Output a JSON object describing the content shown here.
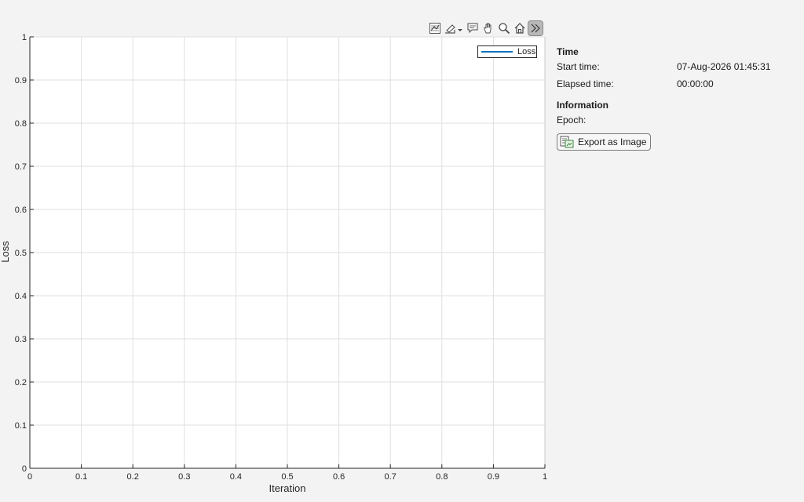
{
  "toolbar": {
    "icons": [
      "export-axes-icon",
      "brush-icon",
      "data-tips-icon",
      "pan-icon",
      "zoom-icon",
      "home-icon",
      "collapse-toolbar-icon"
    ]
  },
  "panel": {
    "time_title": "Time",
    "start_time_label": "Start time:",
    "start_time_value": "07-Aug-2026 01:45:31",
    "elapsed_label": "Elapsed time:",
    "elapsed_value": "00:00:00",
    "info_title": "Information",
    "epoch_label": "Epoch:",
    "epoch_value": "",
    "export_label": "Export as Image"
  },
  "legend": {
    "label": "Loss",
    "color": "#0072bd"
  },
  "chart_data": {
    "type": "line",
    "xlabel": "Iteration",
    "ylabel": "Loss",
    "xlim": [
      0,
      1
    ],
    "ylim": [
      0,
      1
    ],
    "xticks": [
      "0",
      "0.1",
      "0.2",
      "0.3",
      "0.4",
      "0.5",
      "0.6",
      "0.7",
      "0.8",
      "0.9",
      "1"
    ],
    "yticks": [
      "0",
      "0.1",
      "0.2",
      "0.3",
      "0.4",
      "0.5",
      "0.6",
      "0.7",
      "0.8",
      "0.9",
      "1"
    ],
    "grid": true,
    "legend_position": "top-right",
    "series": [
      {
        "name": "Loss",
        "x": [],
        "y": []
      }
    ]
  }
}
